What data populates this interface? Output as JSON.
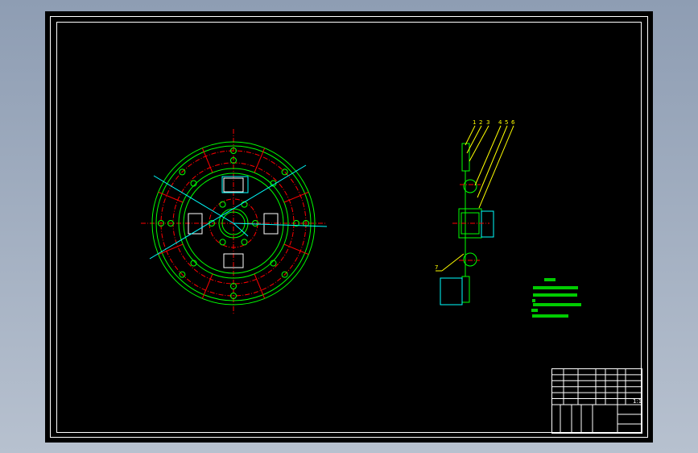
{
  "app": {
    "view": "CAD model space"
  },
  "colors": {
    "background": "#000000",
    "outline": "#00ff00",
    "centerline": "#ff0000",
    "dimension": "#00ffff",
    "leader": "#ffff00",
    "frame": "#ffffff"
  },
  "title_block": {
    "scale": "1:1"
  },
  "side_view": {
    "balloons": [
      "1",
      "2",
      "3",
      "4",
      "5",
      "6",
      "7"
    ]
  }
}
